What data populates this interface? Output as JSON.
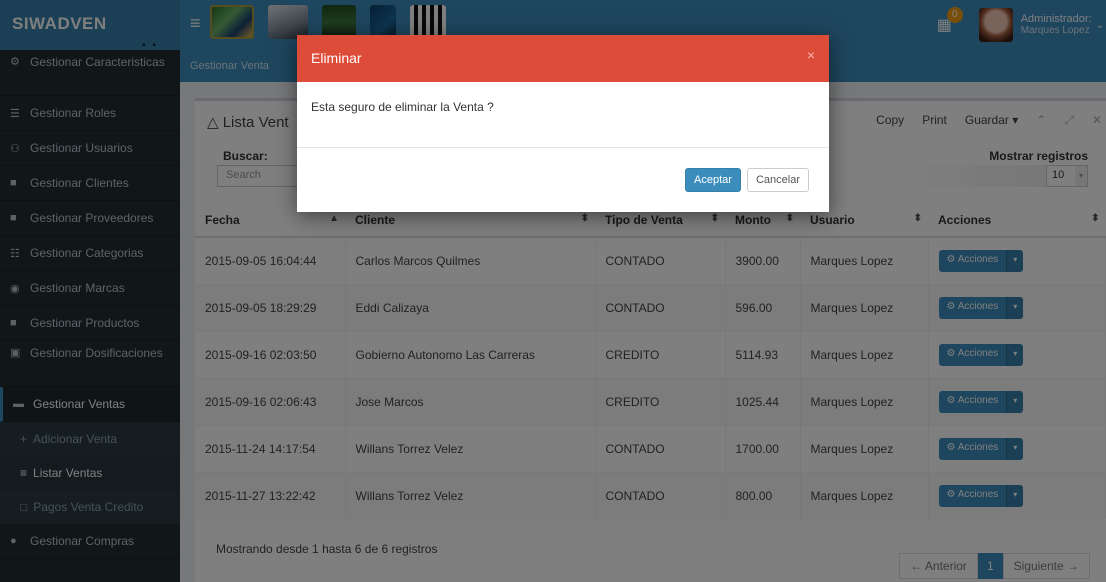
{
  "brand": "SIWADVEN",
  "brand_dots": "▪ ▪",
  "user": {
    "name": "Administrador:",
    "sub": "Marques Lopez",
    "notif_count": "0"
  },
  "sidebar": {
    "items": [
      {
        "label": "Gestionar Caracteristicas",
        "icon": "⚙"
      },
      {
        "label": "Gestionar Roles",
        "icon": "☰"
      },
      {
        "label": "Gestionar Usuarios",
        "icon": "⚇"
      },
      {
        "label": "Gestionar Clientes",
        "icon": "■"
      },
      {
        "label": "Gestionar Proveedores",
        "icon": "■"
      },
      {
        "label": "Gestionar Categorias",
        "icon": "☷"
      },
      {
        "label": "Gestionar Marcas",
        "icon": "◉"
      },
      {
        "label": "Gestionar Productos",
        "icon": "■"
      },
      {
        "label": "Gestionar Dosificaciones",
        "icon": "▣"
      },
      {
        "label": "Gestionar Ventas",
        "icon": "▬"
      }
    ],
    "subitems": [
      {
        "label": "Adicionar Venta",
        "icon": "+"
      },
      {
        "label": "Listar Ventas",
        "icon": "≡"
      },
      {
        "label": "Pagos Venta Credito",
        "icon": "□"
      }
    ],
    "last": {
      "label": "Gestionar Compras",
      "icon": "●"
    }
  },
  "breadcrumb": "Gestionar Venta",
  "box": {
    "title": "Lista Vent",
    "tools": {
      "copy": "Copy",
      "print": "Print",
      "save": "Guardar ▾"
    },
    "search_label": "Buscar:",
    "search_placeholder": "Search",
    "show_label": "Mostrar registros",
    "show_value": "10"
  },
  "table": {
    "headers": [
      "Fecha",
      "Cliente",
      "Tipo de Venta",
      "Monto",
      "Usuario",
      "Acciones"
    ],
    "rows": [
      [
        "2015-09-05 16:04:44",
        "Carlos Marcos Quilmes",
        "CONTADO",
        "3900.00",
        "Marques Lopez"
      ],
      [
        "2015-09-05 18:29:29",
        "Eddi Calizaya",
        "CONTADO",
        "596.00",
        "Marques Lopez"
      ],
      [
        "2015-09-16 02:03:50",
        "Gobierno Autonomo Las Carreras",
        "CREDITO",
        "5114.93",
        "Marques Lopez"
      ],
      [
        "2015-09-16 02:06:43",
        "Jose Marcos",
        "CREDITO",
        "1025.44",
        "Marques Lopez"
      ],
      [
        "2015-11-24 14:17:54",
        "Willans Torrez Velez",
        "CONTADO",
        "1700.00",
        "Marques Lopez"
      ],
      [
        "2015-11-27 13:22:42",
        "Willans Torrez Velez",
        "CONTADO",
        "800.00",
        "Marques Lopez"
      ]
    ],
    "action_label": "⚙ Acciones",
    "action_caret": "▾"
  },
  "footer": {
    "info": "Mostrando desde 1 hasta 6 de 6 registros",
    "prev": "← Anterior",
    "page": "1",
    "next": "Siguiente →"
  },
  "modal": {
    "title": "Eliminar",
    "close": "×",
    "message": "Esta seguro de eliminar la Venta ?",
    "accept": "Aceptar",
    "cancel": "Cancelar"
  },
  "colors": {
    "primary": "#3c8dbc",
    "danger": "#dd4b39",
    "sidebar": "#222d32"
  }
}
